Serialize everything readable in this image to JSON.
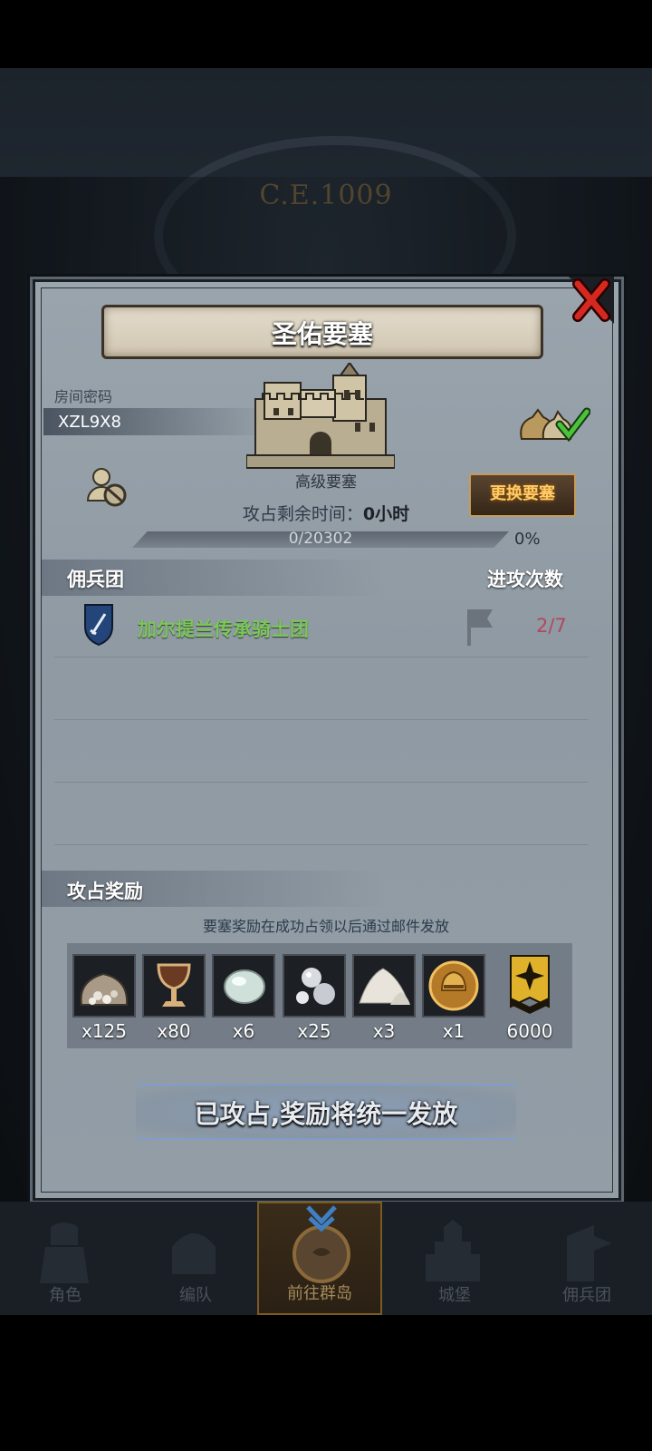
{
  "background": {
    "era": "C.E.1009"
  },
  "dialog": {
    "title": "圣佑要塞",
    "room_code_label": "房间密码",
    "room_code": "XZL9X8",
    "fortress_type": "高级要塞",
    "timer_label": "攻占剩余时间：",
    "timer_value": "0小时",
    "change_button": "更换要塞",
    "progress": {
      "text": "0/20302",
      "percent_text": "0%",
      "fraction": 0
    },
    "mercenary_header": "佣兵团",
    "attack_count_header": "进攻次数",
    "mercenaries": [
      {
        "name": "加尔提兰传承骑士团",
        "count": "2/7"
      }
    ],
    "reward_header": "攻占奖励",
    "reward_note": "要塞奖励在成功占领以后通过邮件发放",
    "rewards": [
      {
        "icon": "silver-pouch-icon",
        "count": "x125"
      },
      {
        "icon": "goblet-icon",
        "count": "x80"
      },
      {
        "icon": "gemstone-icon",
        "count": "x6"
      },
      {
        "icon": "pearls-icon",
        "count": "x25"
      },
      {
        "icon": "powder-pile-icon",
        "count": "x3"
      },
      {
        "icon": "knight-helmet-medal-icon",
        "count": "x1"
      },
      {
        "icon": "rank-badge-icon",
        "count": "6000"
      }
    ],
    "claim_button": "已攻占,奖励将统一发放"
  },
  "nav": {
    "items": [
      {
        "label": "角色"
      },
      {
        "label": "编队"
      },
      {
        "label": "前往群岛"
      },
      {
        "label": "城堡"
      },
      {
        "label": "佣兵团"
      }
    ]
  },
  "colors": {
    "accent_gold": "#ffcb6b",
    "merc_green": "#7bc65a",
    "count_red": "#b2485c"
  }
}
